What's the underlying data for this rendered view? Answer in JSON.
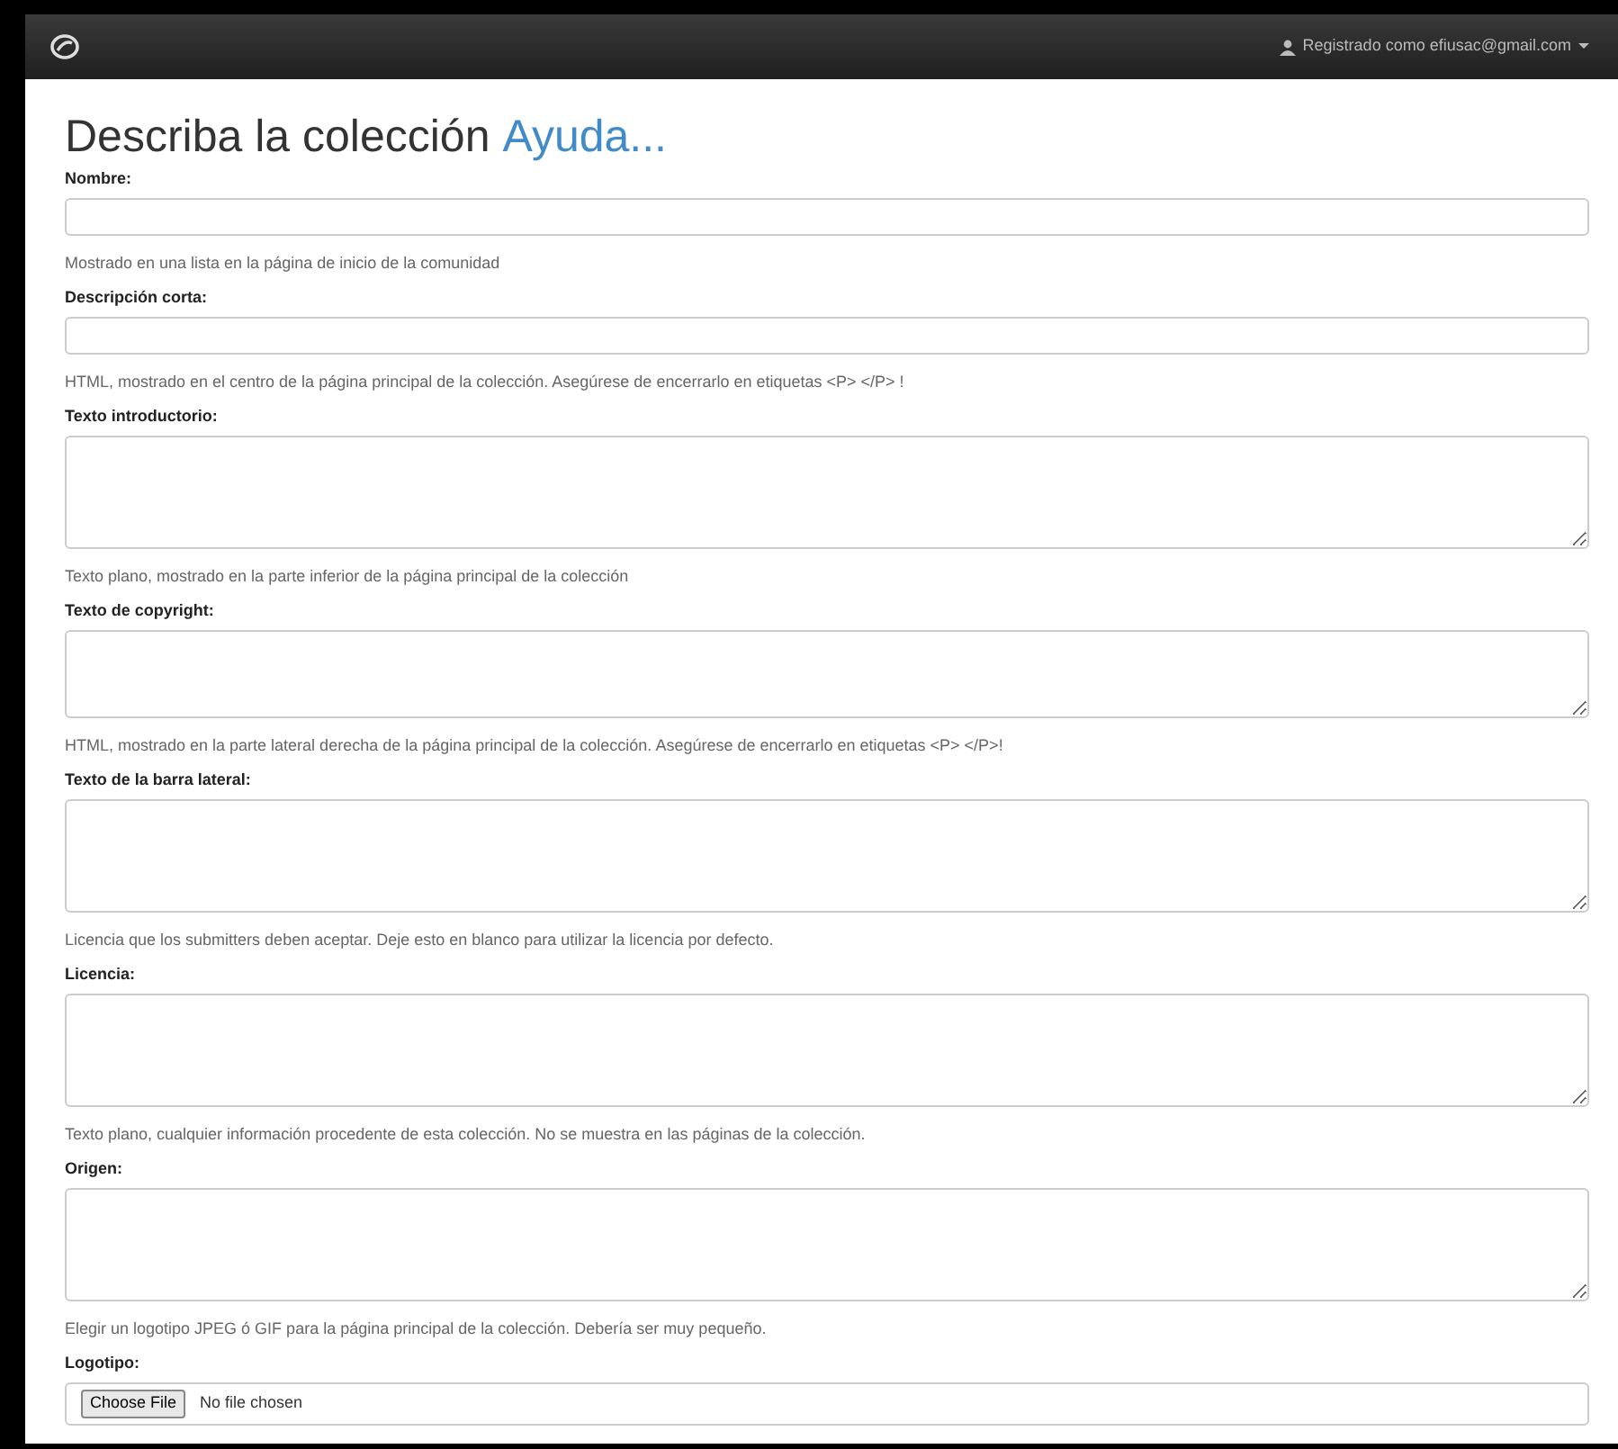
{
  "navbar": {
    "user_menu": "Registrado como efiusac@gmail.com"
  },
  "title": "Describa la colección",
  "help_link": "Ayuda...",
  "fields": [
    {
      "label": "Nombre:",
      "kind": "input",
      "help": "Mostrado en una lista en la página de inicio de la comunidad"
    },
    {
      "label": "Descripción corta:",
      "kind": "input",
      "help": "HTML, mostrado en el centro de la página principal de la colección. Asegúrese de encerrarlo en etiquetas <P> </P> !"
    },
    {
      "label": "Texto introductorio:",
      "kind": "textarea",
      "help": "Texto plano, mostrado en la parte inferior de la página principal de la colección"
    },
    {
      "label": "Texto de copyright:",
      "kind": "textarea",
      "help": "HTML, mostrado en la parte lateral derecha de la página principal de la colección. Asegúrese de encerrarlo en etiquetas <P> </P>!"
    },
    {
      "label": "Texto de la barra lateral:",
      "kind": "textarea",
      "help": "Licencia que los submitters deben aceptar. Deje esto en blanco para utilizar la licencia por defecto."
    },
    {
      "label": "Licencia:",
      "kind": "textarea",
      "help": "Texto plano, cualquier información procedente de esta colección. No se muestra en las páginas de la colección."
    },
    {
      "label": "Origen:",
      "kind": "textarea",
      "help": "Elegir un logotipo JPEG ó GIF para la página principal de la colección. Debería ser muy pequeño."
    },
    {
      "label": "Logotipo:",
      "kind": "file",
      "button": "Choose File",
      "status": "No file chosen"
    }
  ]
}
